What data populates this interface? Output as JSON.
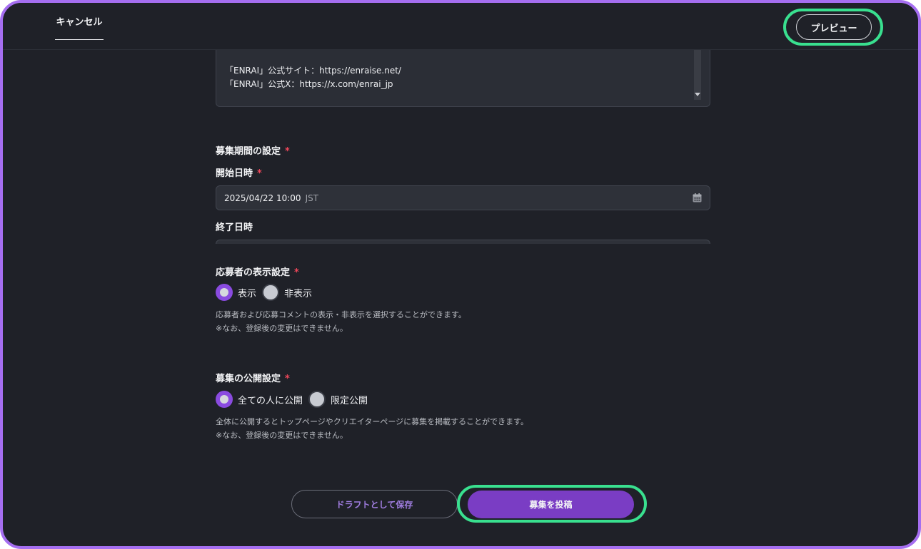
{
  "header": {
    "cancel_label": "キャンセル",
    "preview_label": "プレビュー"
  },
  "description": {
    "lines": [
      "「ENRAI」公式サイト：https://enraise.net/",
      "「ENRAI」公式X：https://x.com/enrai_jp"
    ]
  },
  "period": {
    "section_label": "募集期間の設定",
    "start_label": "開始日時",
    "start_value": "2025/04/22 10:00",
    "start_tz": "JST",
    "end_label": "終了日時",
    "required_mark": "*"
  },
  "applicant_display": {
    "section_label": "応募者の表示設定",
    "options": [
      {
        "label": "表示",
        "selected": true
      },
      {
        "label": "非表示",
        "selected": false
      }
    ],
    "help_lines": [
      "応募者および応募コメントの表示・非表示を選択することができます。",
      "※なお、登録後の変更はできません。"
    ]
  },
  "visibility": {
    "section_label": "募集の公開設定",
    "options": [
      {
        "label": "全ての人に公開",
        "selected": true
      },
      {
        "label": "限定公開",
        "selected": false
      }
    ],
    "help_lines": [
      "全体に公開するとトップページやクリエイターページに募集を掲載することができます。",
      "※なお、登録後の変更はできません。"
    ]
  },
  "footer": {
    "draft_label": "ドラフトとして保存",
    "post_label": "募集を投稿"
  },
  "colors": {
    "accent": "#7a3dc4",
    "highlight": "#39e08f",
    "required": "#f0475a",
    "background": "#1f2128"
  }
}
